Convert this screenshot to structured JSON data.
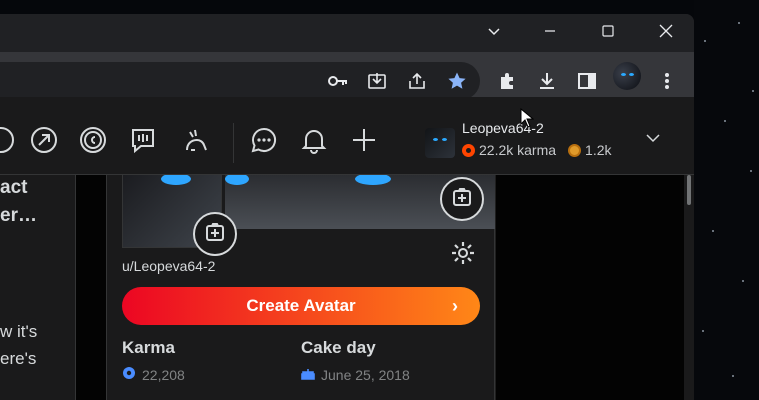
{
  "user": {
    "name": "Leopeva64-2",
    "karma_short": "22.2k karma",
    "coins": "1.2k",
    "handle": "u/Leopeva64-2"
  },
  "left_partial": {
    "title_line1": "act",
    "title_line2": "er…",
    "text_line1": "w it's",
    "text_line2": "ere's"
  },
  "profile": {
    "create_avatar": "Create Avatar",
    "create_arrow": "›",
    "karma_label": "Karma",
    "karma_value": "22,208",
    "cakeday_label": "Cake day",
    "cakeday_value": "June 25, 2018"
  },
  "icons": {
    "window": [
      "chevron-down-icon",
      "minimize-icon",
      "maximize-icon",
      "close-icon"
    ],
    "toolbar": [
      "key-icon",
      "install-icon",
      "share-icon",
      "star-icon",
      "extensions-icon",
      "download-icon",
      "sidepanel-icon",
      "menu-icon"
    ],
    "reddit": [
      "popular-icon",
      "coins-icon",
      "rpan-icon",
      "avatar-shop-icon",
      "chat-icon",
      "bell-icon",
      "plus-icon"
    ]
  },
  "colors": {
    "create_start": "#ec0623",
    "create_end": "#ff8717",
    "accent_blue": "#2ea6ff",
    "karma": "#ff4500"
  }
}
